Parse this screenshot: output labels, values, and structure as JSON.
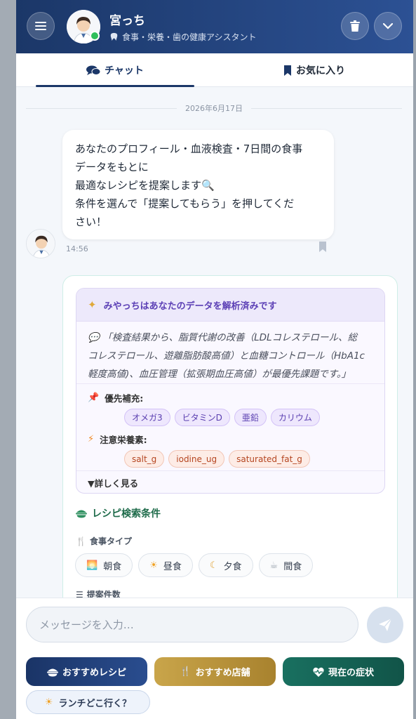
{
  "header": {
    "title": "宮っち",
    "subtitle": "食事・栄養・歯の健康アシスタント",
    "menu_icon": "hamburger-menu-icon",
    "delete_icon": "trash-icon",
    "collapse_icon": "chevron-down-icon"
  },
  "tabs": [
    {
      "label": "チャット",
      "icon": "chat-bubbles-icon",
      "active": true
    },
    {
      "label": "お気に入り",
      "icon": "bookmark-icon",
      "active": false
    }
  ],
  "chat": {
    "date": "2026年6月17日",
    "message": {
      "lines": [
        "あなたのプロフィール・血液検査・7日間の食事",
        "データをもとに",
        "最適なレシピを提案します🔍",
        "条件を選んで「提案してもらう」を押してくだ",
        "さい！"
      ],
      "time": "14:56"
    }
  },
  "analysis": {
    "title": "みやっちはあなたのデータを解析済みです",
    "quote_lines": [
      "💬 「検査結果から、脂質代謝の改善（LDLコレステロール、総",
      "コレステロール、遊離脂肪酸高値）と血糖コントロール（HbA1c",
      "軽度高値)、血圧管理（拡張期血圧高値）が最優先課題です。」"
    ],
    "priority_label": "優先補充:",
    "priority_chips": [
      "オメガ3",
      "ビタミンD",
      "亜鉛",
      "カリウム"
    ],
    "caution_label": "注意栄養素:",
    "caution_chips": [
      "salt_g",
      "iodine_ug",
      "saturated_fat_g"
    ],
    "detail_label": "▼詳しく見る"
  },
  "recipe_search": {
    "title": "レシピ検索条件",
    "meal_type_label": "食事タイプ",
    "meal_types": [
      {
        "label": "朝食",
        "icon": "sunrise-icon"
      },
      {
        "label": "昼食",
        "icon": "sun-icon"
      },
      {
        "label": "夕食",
        "icon": "moon-icon"
      },
      {
        "label": "間食",
        "icon": "snack-icon"
      }
    ],
    "count_label": "提案件数"
  },
  "input": {
    "placeholder": "メッセージを入力…"
  },
  "quick_actions": [
    {
      "label": "おすすめレシピ",
      "color": "#1e3a70"
    },
    {
      "label": "おすすめ店舗",
      "color": "#bf9a3c"
    },
    {
      "label": "現在の症状",
      "color": "#196b5c"
    }
  ],
  "lunch_button": {
    "label": "ランチどこ行く？"
  },
  "colors": {
    "header": "#1b3768",
    "accent_purple": "#5b3fb5",
    "accent_green": "#1e6b4a"
  }
}
